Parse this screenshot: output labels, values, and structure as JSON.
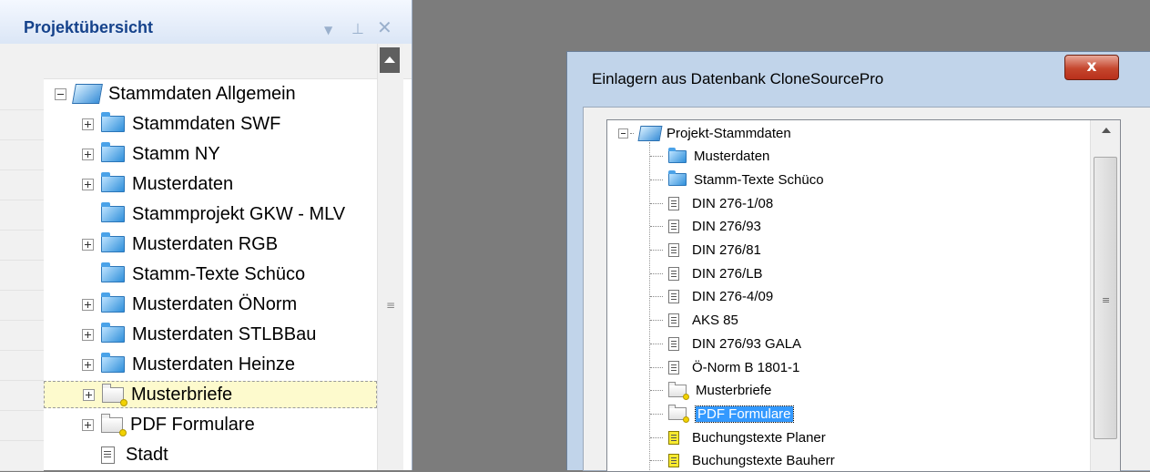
{
  "left_panel": {
    "title": "Projektübersicht",
    "header_icons": [
      "dropdown-arrow-icon",
      "pin-icon",
      "close-icon"
    ],
    "tree": [
      {
        "label": "Stammdaten Allgemein",
        "expander": "minus",
        "icon": "folder-stack"
      },
      {
        "label": "Stammdaten SWF",
        "expander": "plus",
        "icon": "folder-blue"
      },
      {
        "label": "Stamm NY",
        "expander": "plus",
        "icon": "folder-blue"
      },
      {
        "label": "Musterdaten",
        "expander": "plus",
        "icon": "folder-blue"
      },
      {
        "label": "Stammprojekt GKW - MLV",
        "expander": "none",
        "icon": "folder-blue"
      },
      {
        "label": "Musterdaten RGB",
        "expander": "plus",
        "icon": "folder-blue"
      },
      {
        "label": "Stamm-Texte Schüco",
        "expander": "none",
        "icon": "folder-blue"
      },
      {
        "label": "Musterdaten ÖNorm",
        "expander": "plus",
        "icon": "folder-blue"
      },
      {
        "label": "Musterdaten STLBBau",
        "expander": "plus",
        "icon": "folder-blue"
      },
      {
        "label": "Musterdaten Heinze",
        "expander": "plus",
        "icon": "folder-blue"
      },
      {
        "label": "Musterbriefe",
        "expander": "plus",
        "icon": "folder-gray",
        "selected": true
      },
      {
        "label": "PDF Formulare",
        "expander": "plus",
        "icon": "folder-gray"
      },
      {
        "label": "Stadt",
        "expander": "none",
        "icon": "document"
      }
    ]
  },
  "dialog": {
    "title": "Einlagern aus Datenbank CloneSourcePro",
    "close_label": "x",
    "tree": [
      {
        "label": "Projekt-Stammdaten",
        "icon": "folder-stack",
        "root": true
      },
      {
        "label": "Musterdaten",
        "icon": "folder-blue"
      },
      {
        "label": "Stamm-Texte Schüco",
        "icon": "folder-blue"
      },
      {
        "label": "DIN 276-1/08",
        "icon": "document"
      },
      {
        "label": "DIN 276/93",
        "icon": "document"
      },
      {
        "label": "DIN 276/81",
        "icon": "document"
      },
      {
        "label": "DIN 276/LB",
        "icon": "document"
      },
      {
        "label": "DIN 276-4/09",
        "icon": "document"
      },
      {
        "label": "AKS 85",
        "icon": "document"
      },
      {
        "label": "DIN 276/93 GALA",
        "icon": "document"
      },
      {
        "label": "Ö-Norm B 1801-1",
        "icon": "document"
      },
      {
        "label": "Musterbriefe",
        "icon": "folder-gray"
      },
      {
        "label": "PDF Formulare",
        "icon": "folder-gray",
        "highlighted": true
      },
      {
        "label": "Buchungstexte Planer",
        "icon": "document-yellow"
      },
      {
        "label": "Buchungstexte Bauherr",
        "icon": "document-yellow"
      }
    ]
  },
  "colors": {
    "panel_title": "#15428b",
    "selection_bg": "#fdfacd",
    "highlight_bg": "#3399ff",
    "workspace": "#7c7c7c",
    "dialog_frame": "#c1d4ea",
    "close_button": "#c5462d"
  }
}
